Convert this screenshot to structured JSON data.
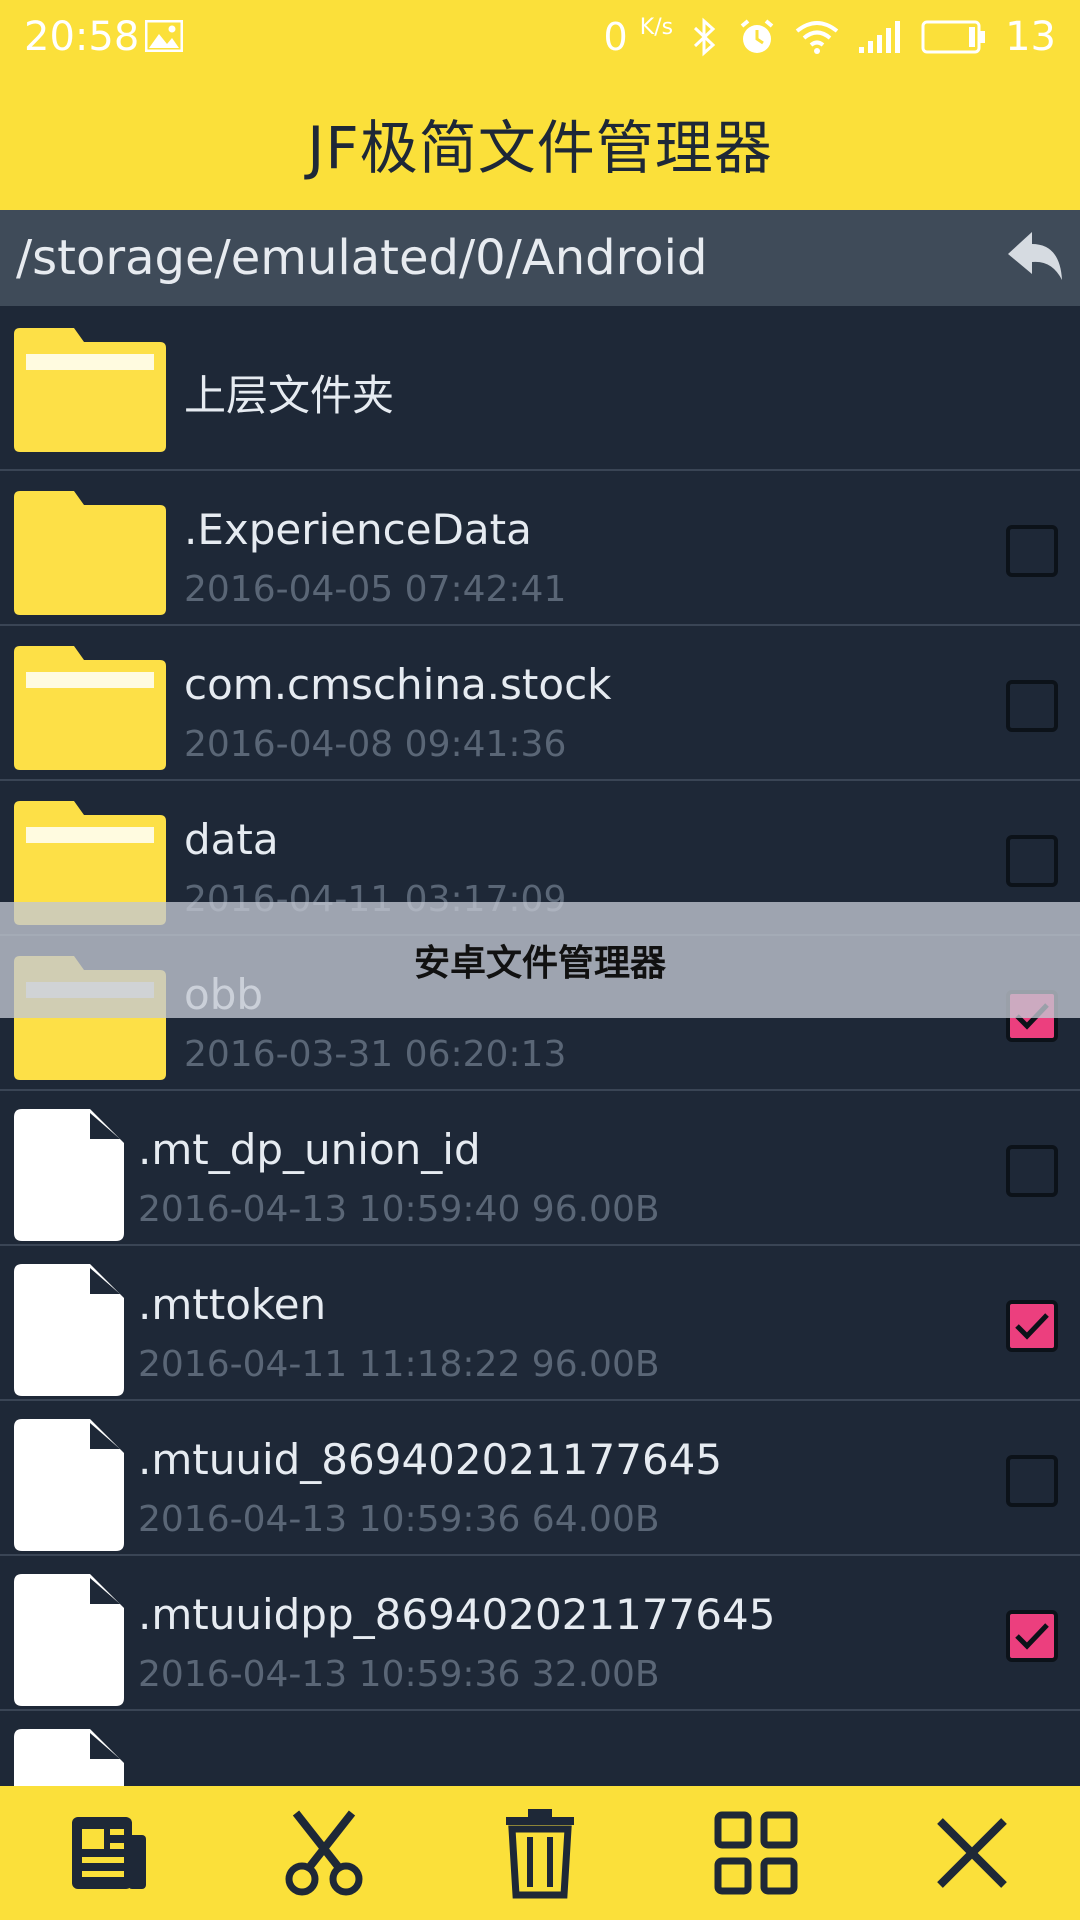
{
  "status_bar": {
    "time": "20:58",
    "net_speed_value": "0",
    "net_speed_unit": "K/s",
    "battery_level": "13",
    "icons": [
      "image-icon",
      "bluetooth-icon",
      "alarm-icon",
      "wifi-icon",
      "signal-icon",
      "battery-icon"
    ]
  },
  "header": {
    "title": "JF极简文件管理器"
  },
  "path_bar": {
    "path": "/storage/emulated/0/Android",
    "back_icon": "back-arrow-icon"
  },
  "list": {
    "parent_label": "上层文件夹",
    "folders": [
      {
        "name": ".ExperienceData",
        "meta": "2016-04-05 07:42:41",
        "checked": false
      },
      {
        "name": "com.cmschina.stock",
        "meta": "2016-04-08 09:41:36",
        "checked": false
      },
      {
        "name": "data",
        "meta": "2016-04-11 03:17:09",
        "checked": false
      },
      {
        "name": "obb",
        "meta": "2016-03-31 06:20:13",
        "checked": true
      }
    ],
    "files": [
      {
        "name": ".mt_dp_union_id",
        "meta": "2016-04-13 10:59:40 96.00B",
        "checked": false
      },
      {
        "name": ".mttoken",
        "meta": "2016-04-11 11:18:22 96.00B",
        "checked": true
      },
      {
        "name": ".mtuuid_869402021177645",
        "meta": "2016-04-13 10:59:36 64.00B",
        "checked": false
      },
      {
        "name": ".mtuuidpp_869402021177645",
        "meta": "2016-04-13 10:59:36 32.00B",
        "checked": true
      }
    ]
  },
  "overlay": {
    "caption": "安卓文件管理器"
  },
  "toolbar": {
    "items": [
      "document-icon",
      "scissors-icon",
      "trash-icon",
      "grid-icon",
      "close-icon"
    ]
  },
  "colors": {
    "accent": "#fbe03a",
    "background": "#1e2837",
    "path_bar": "#3f4b59",
    "checked": "#ec3f7e",
    "folder": "#fde047"
  }
}
